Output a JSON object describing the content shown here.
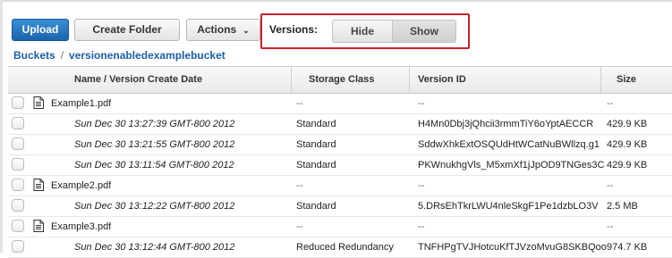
{
  "toolbar": {
    "upload_label": "Upload",
    "create_folder_label": "Create Folder",
    "actions_label": "Actions",
    "actions_caret": "⌄"
  },
  "versions": {
    "label": "Versions:",
    "hide_label": "Hide",
    "show_label": "Show",
    "selected": "Show"
  },
  "breadcrumb": {
    "root": "Buckets",
    "separator": "/",
    "current": "versionenabledexamplebucket"
  },
  "table": {
    "columns": [
      "Name / Version Create Date",
      "Storage Class",
      "Version ID",
      "Size"
    ],
    "rows": [
      {
        "kind": "file",
        "name": "Example1.pdf",
        "storage_class": "--",
        "version_id": "--",
        "size": "--"
      },
      {
        "kind": "version",
        "date": "Sun Dec 30 13:27:39 GMT-800 2012",
        "storage_class": "Standard",
        "version_id": "H4Mn0Dbj3jQhcii3rmmTiY6oYptAECCR",
        "size": "429.9 KB"
      },
      {
        "kind": "version",
        "date": "Sun Dec 30 13:21:55 GMT-800 2012",
        "storage_class": "Standard",
        "version_id": "SddwXhkExtOSQUdHtWCatNuBWllzq.g1",
        "size": "429.9 KB"
      },
      {
        "kind": "version",
        "date": "Sun Dec 30 13:11:54 GMT-800 2012",
        "storage_class": "Standard",
        "version_id": "PKWnukhgVls_M5xmXf1jJpOD9TNGes3C",
        "size": "429.9 KB"
      },
      {
        "kind": "file",
        "name": "Example2.pdf",
        "storage_class": "--",
        "version_id": "--",
        "size": "--"
      },
      {
        "kind": "version",
        "date": "Sun Dec 30 13:12:22 GMT-800 2012",
        "storage_class": "Standard",
        "version_id": "5.DRsEhTkrLWU4nleSkgF1Pe1dzbLO3V",
        "size": "2.5 MB"
      },
      {
        "kind": "file",
        "name": "Example3.pdf",
        "storage_class": "--",
        "version_id": "--",
        "size": "--"
      },
      {
        "kind": "version",
        "date": "Sun Dec 30 13:12:44 GMT-800 2012",
        "storage_class": "Reduced Redundancy",
        "version_id": "TNFHPgTVJHotcuKfTJVzoMvuG8SKBQoo",
        "size": "974.7 KB"
      }
    ]
  },
  "icons": {
    "file": "document-icon",
    "caret": "chevron-down-icon"
  },
  "colors": {
    "primary": "#1f6fbd",
    "link": "#1f5fa8",
    "highlight_border": "#c8202c"
  }
}
